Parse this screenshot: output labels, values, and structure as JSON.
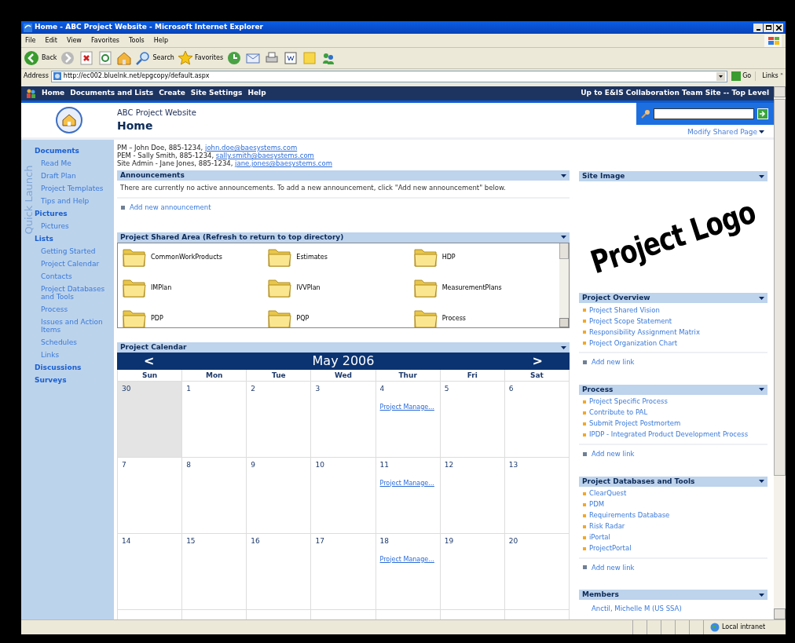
{
  "window": {
    "title": "Home - ABC Project Website - Microsoft Internet Explorer"
  },
  "menu": [
    "File",
    "Edit",
    "View",
    "Favorites",
    "Tools",
    "Help"
  ],
  "toolbar": {
    "back": "Back",
    "search": "Search",
    "favorites": "Favorites"
  },
  "address": {
    "label": "Address",
    "url": "http://ec002.bluelnk.net/epgcopy/default.aspx",
    "go": "Go",
    "links": "Links",
    "links_chevron": "»"
  },
  "site_nav": {
    "items": [
      "Home",
      "Documents and Lists",
      "Create",
      "Site Settings",
      "Help"
    ],
    "up_link": "Up to E&IS Collaboration Team Site -- Top Level"
  },
  "header": {
    "site": "ABC Project Website",
    "page": "Home",
    "modify": "Modify Shared Page"
  },
  "quick_launch": {
    "watermark": "Quick Launch",
    "sections": [
      {
        "title": "Documents",
        "items": [
          "Read Me",
          "Draft Plan",
          "Project Templates",
          "Tips and Help"
        ]
      },
      {
        "title": "Pictures",
        "items": [
          "Pictures"
        ]
      },
      {
        "title": "Lists",
        "items": [
          "Getting Started",
          "Project Calendar",
          "Contacts",
          "Project Databases and Tools",
          "Process",
          "Issues and Action Items",
          "Schedules",
          "Links"
        ]
      },
      {
        "title": "Discussions"
      },
      {
        "title": "Surveys"
      }
    ]
  },
  "contacts": [
    {
      "text": "PM – John Doe, 885-1234, ",
      "email": "john.doe@baesystems.com"
    },
    {
      "text": "PEM - Sally Smith, 885-1234, ",
      "email": "sally.smith@baesystems.com"
    },
    {
      "text": "Site Admin - Jane Jones, 885-1234, ",
      "email": "jane.jones@baesystems.com"
    }
  ],
  "announcements": {
    "title": "Announcements",
    "message": "There are currently no active announcements. To add a new announcement, click \"Add new announcement\" below.",
    "add": "Add new announcement"
  },
  "shared_area": {
    "title": "Project Shared Area (Refresh to return to top directory)",
    "folders": [
      "CommonWorkProducts",
      "Estimates",
      "HDP",
      "IMPlan",
      "IVVPlan",
      "MeasurementPlans",
      "PDP",
      "PQP",
      "Process"
    ]
  },
  "calendar": {
    "title": "Project Calendar",
    "prev": "<",
    "next": ">",
    "month": "May 2006",
    "days": [
      "Sun",
      "Mon",
      "Tue",
      "Wed",
      "Thur",
      "Fri",
      "Sat"
    ],
    "weeks": [
      [
        {
          "day": "30",
          "other_month": true
        },
        {
          "day": "1",
          "other_month": false
        },
        {
          "day": "2",
          "other_month": false
        },
        {
          "day": "3",
          "other_month": false
        },
        {
          "day": "4",
          "other_month": false,
          "event": "Project Manage..."
        },
        {
          "day": "5",
          "other_month": false
        },
        {
          "day": "6",
          "other_month": false
        }
      ],
      [
        {
          "day": "7",
          "other_month": false
        },
        {
          "day": "8",
          "other_month": false
        },
        {
          "day": "9",
          "other_month": false
        },
        {
          "day": "10",
          "other_month": false
        },
        {
          "day": "11",
          "other_month": false,
          "event": "Project Manage..."
        },
        {
          "day": "12",
          "other_month": false
        },
        {
          "day": "13",
          "other_month": false
        }
      ],
      [
        {
          "day": "14",
          "other_month": false
        },
        {
          "day": "15",
          "other_month": false
        },
        {
          "day": "16",
          "other_month": false
        },
        {
          "day": "17",
          "other_month": false
        },
        {
          "day": "18",
          "other_month": false,
          "event": "Project Manage..."
        },
        {
          "day": "19",
          "other_month": false
        },
        {
          "day": "20",
          "other_month": false
        }
      ]
    ]
  },
  "site_image": {
    "title": "Site Image",
    "text": "Project Logo"
  },
  "link_lists": [
    {
      "title": "Project Overview",
      "links": [
        "Project Shared Vision",
        "Project Scope Statement",
        "Responsibility Assignment Matrix",
        "Project Organization Chart"
      ],
      "add": "Add new link"
    },
    {
      "title": "Process",
      "links": [
        "Project Specific Process",
        "Contribute to PAL",
        "Submit Project Postmortem",
        "IPDP - Integrated Product Development Process"
      ],
      "add": "Add new link"
    },
    {
      "title": "Project Databases and Tools",
      "links": [
        "ClearQuest",
        "PDM",
        "Requirements Database",
        "Risk Radar",
        "iPortal",
        "ProjectPortal"
      ],
      "add": "Add new link"
    }
  ],
  "members": {
    "title": "Members",
    "names": [
      "Anctil, Michelle M (US SSA)"
    ]
  },
  "status": {
    "zone": "Local intranet"
  }
}
